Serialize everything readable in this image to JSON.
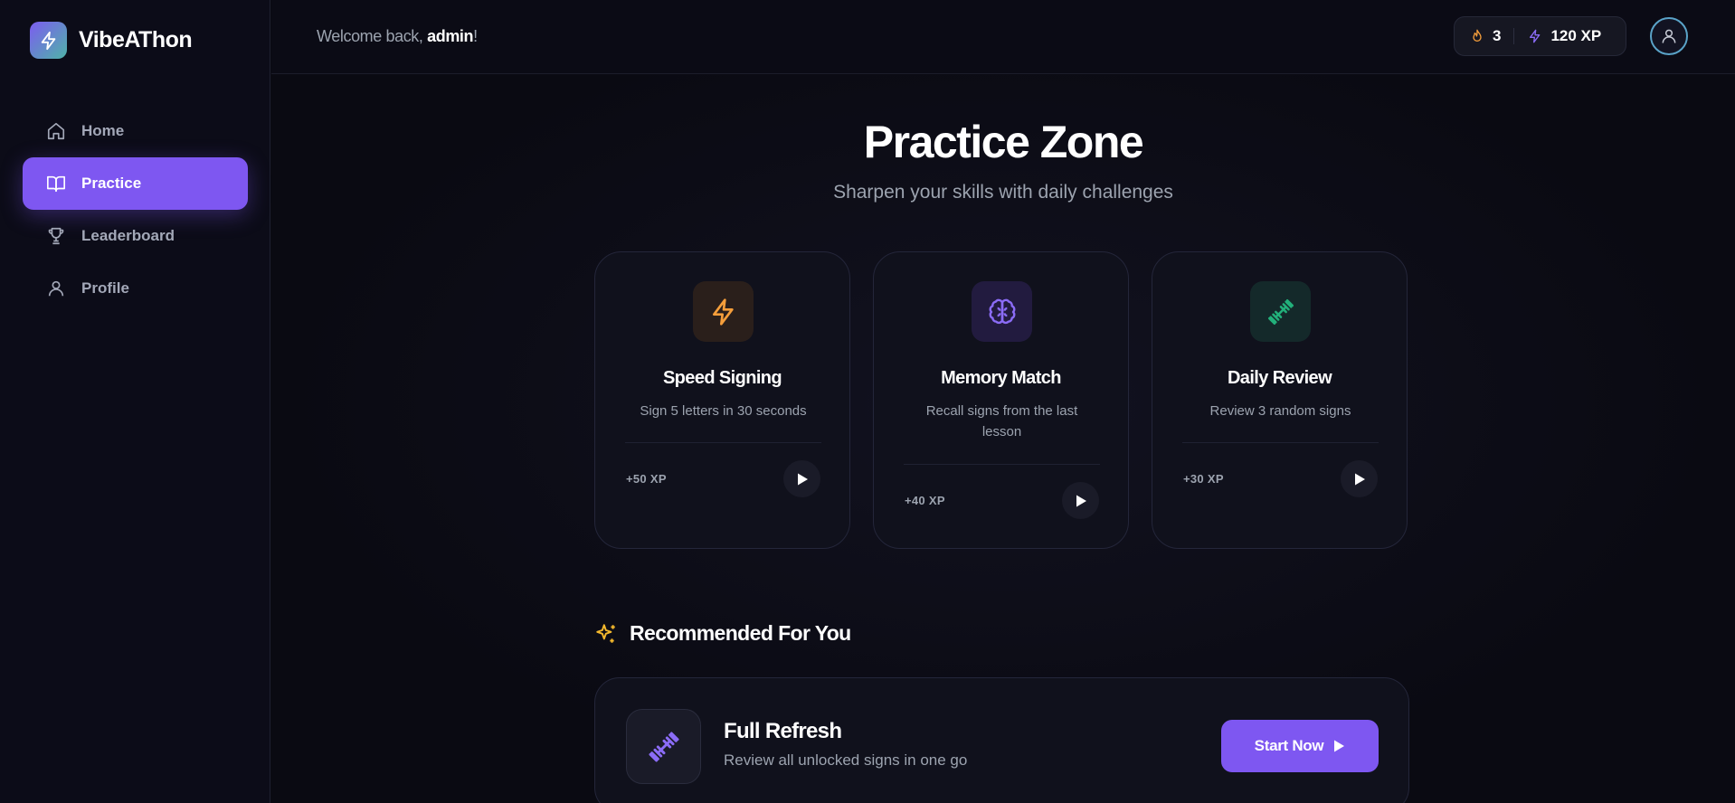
{
  "app": {
    "name": "VibeAThon"
  },
  "sidebar": {
    "items": [
      {
        "label": "Home",
        "icon": "home-icon",
        "active": false
      },
      {
        "label": "Practice",
        "icon": "book-open-icon",
        "active": true
      },
      {
        "label": "Leaderboard",
        "icon": "trophy-icon",
        "active": false
      },
      {
        "label": "Profile",
        "icon": "user-icon",
        "active": false
      }
    ]
  },
  "header": {
    "welcome_prefix": "Welcome back, ",
    "username": "admin",
    "welcome_suffix": "!",
    "streak": "3",
    "xp": "120 XP"
  },
  "main": {
    "title": "Practice Zone",
    "subtitle": "Sharpen your skills with daily challenges",
    "cards": [
      {
        "title": "Speed Signing",
        "description": "Sign 5 letters in 30 seconds",
        "xp": "+50 XP",
        "icon": "lightning-icon",
        "accent": "#f59e3b"
      },
      {
        "title": "Memory Match",
        "description": "Recall signs from the last lesson",
        "xp": "+40 XP",
        "icon": "brain-icon",
        "accent": "#8b6cf6"
      },
      {
        "title": "Daily Review",
        "description": "Review 3 random signs",
        "xp": "+30 XP",
        "icon": "dumbbell-icon",
        "accent": "#22b07a"
      }
    ],
    "recommended": {
      "heading": "Recommended For You",
      "title": "Full Refresh",
      "description": "Review all unlocked signs in one go",
      "button_label": "Start Now"
    }
  },
  "colors": {
    "accent": "#7e57f1",
    "background": "#0a0a12",
    "streak": "#f59e3b",
    "xp": "#8b6cf6"
  }
}
